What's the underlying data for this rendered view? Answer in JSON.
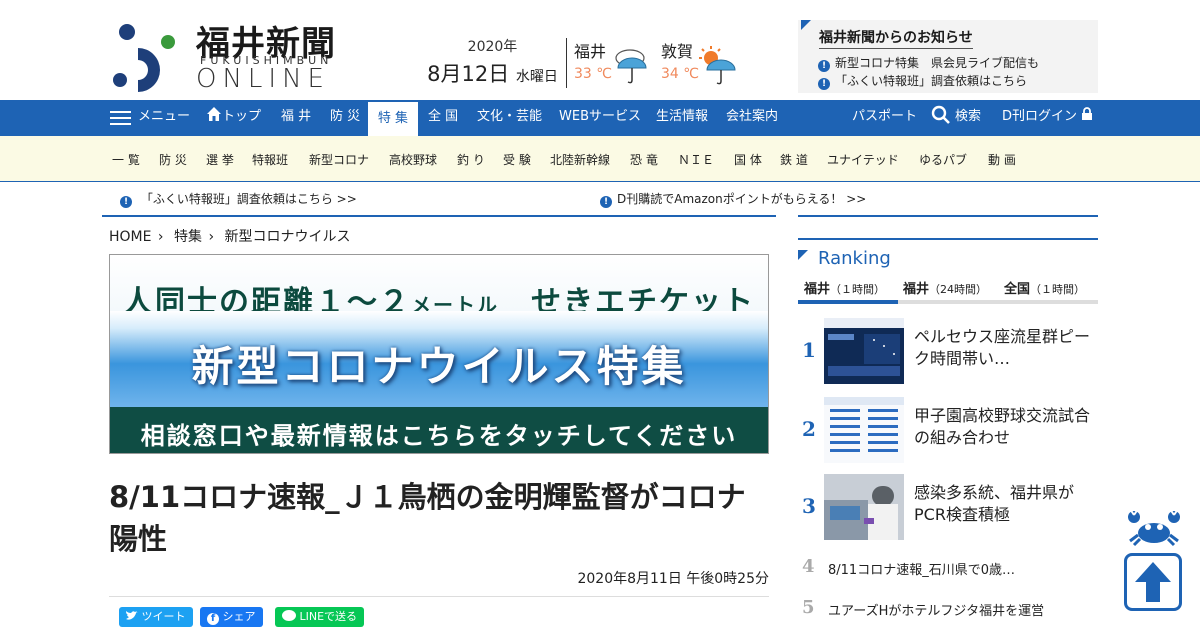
{
  "header": {
    "logo_title": "福井新聞",
    "logo_sub": "FUKUISHIMBUN",
    "logo_online": "ONLINE",
    "date_year": "2020年",
    "date_main": "8月12日",
    "date_dow": "水曜日",
    "weather": [
      {
        "city": "福井",
        "temp": "33 ℃",
        "icon": "rain-umbrella-icon"
      },
      {
        "city": "敦賀",
        "temp": "34 ℃",
        "icon": "sun-umbrella-icon"
      }
    ],
    "notice": {
      "title": "福井新聞からのお知らせ",
      "items": [
        "新型コロナ特集　県会見ライブ配信も",
        "「ふくい特報班」調査依頼はこちら"
      ]
    }
  },
  "nav": {
    "menu_label": "メニュー",
    "items": [
      "トップ",
      "福 井",
      "防 災",
      "特 集",
      "全 国",
      "文化・芸能",
      "WEBサービス",
      "生活情報",
      "会社案内"
    ],
    "passport": "パスポート",
    "search": "検索",
    "login": "D刊ログイン"
  },
  "subnav": [
    "一 覧",
    "防 災",
    "選 挙",
    "特報班",
    "新型コロナ",
    "高校野球",
    "釣 り",
    "受 験",
    "北陸新幹線",
    "恐 竜",
    "ＮＩＥ",
    "国 体",
    "鉄 道",
    "ユナイテッド",
    "ゆるパブ",
    "動 画"
  ],
  "ticker": [
    "「ふくい特報班」調査依頼はこちら >>",
    "D刊購読でAmazonポイントがもらえる！ >>"
  ],
  "breadcrumb": [
    "HOME",
    "特集",
    "新型コロナウイルス"
  ],
  "banner": {
    "line1_a": "人同士の距離１～２",
    "line1_b": "メートル",
    "line1_c": "せきエチケット",
    "line2": "新型コロナウイルス特集",
    "line3": "相談窓口や最新情報はこちらをタッチしてください"
  },
  "article": {
    "headline": "8/11コロナ速報_Ｊ１鳥栖の金明輝監督がコロナ陽性",
    "date": "2020年8月11日 午後0時25分"
  },
  "share": {
    "tweet": "ツイート",
    "facebook": "シェア",
    "line": "LINEで送る"
  },
  "ranking": {
    "title": "Ranking",
    "tabs": [
      {
        "name": "福井",
        "period": "（１時間）"
      },
      {
        "name": "福井",
        "period": "（24時間）"
      },
      {
        "name": "全国",
        "period": "（１時間）"
      }
    ],
    "items": [
      {
        "rank": "1",
        "title": "ペルセウス座流星群ピーク時間帯い…"
      },
      {
        "rank": "2",
        "title": "甲子園高校野球交流試合の組み合わせ"
      },
      {
        "rank": "3",
        "title": "感染多系統、福井県がPCR検査積極"
      },
      {
        "rank": "4",
        "title": "8/11コロナ速報_石川県で0歳…"
      },
      {
        "rank": "5",
        "title": "ユアーズHがホテルフジタ福井を運営"
      }
    ]
  },
  "colors": {
    "brand": "#1e63b4",
    "subnav_bg": "#fbfae4",
    "temp": "#f08a5d",
    "banner_green": "#0f4d44"
  }
}
